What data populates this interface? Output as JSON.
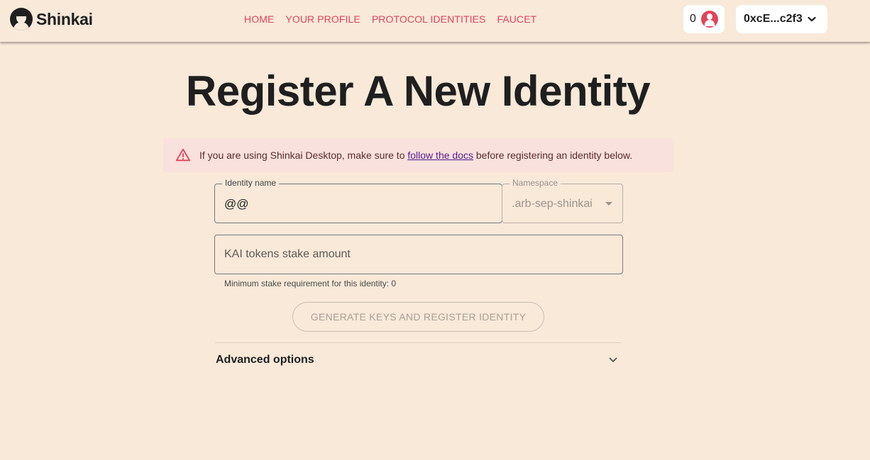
{
  "brand": {
    "name": "Shinkai"
  },
  "nav": {
    "items": [
      {
        "label": "HOME"
      },
      {
        "label": "YOUR PROFILE"
      },
      {
        "label": "PROTOCOL IDENTITIES"
      },
      {
        "label": "FAUCET"
      }
    ]
  },
  "header": {
    "token_count": "0",
    "wallet_address": "0xcE...c2f3",
    "wallet_chevron": "❯"
  },
  "page": {
    "title": "Register A New Identity"
  },
  "alert": {
    "prefix": "If you are using Shinkai Desktop, make sure to ",
    "link": "follow the docs",
    "suffix": " before registering an identity below."
  },
  "form": {
    "identity_label": "Identity name",
    "identity_value": "@@",
    "namespace_label": "Namespace",
    "namespace_value": ".arb-sep-shinkai",
    "stake_placeholder": "KAI tokens stake amount",
    "stake_helper": "Minimum stake requirement for this identity: 0",
    "submit_label": "GENERATE KEYS AND REGISTER IDENTITY"
  },
  "advanced": {
    "label": "Advanced options"
  },
  "colors": {
    "background": "#f8e9d9",
    "accent": "#e0445a",
    "alert_bg": "#f9e1dd"
  },
  "icons": [
    "shinkai-logo-icon",
    "user-avatar-icon",
    "chevron-down-icon",
    "warning-triangle-icon",
    "expand-chevron-icon"
  ]
}
